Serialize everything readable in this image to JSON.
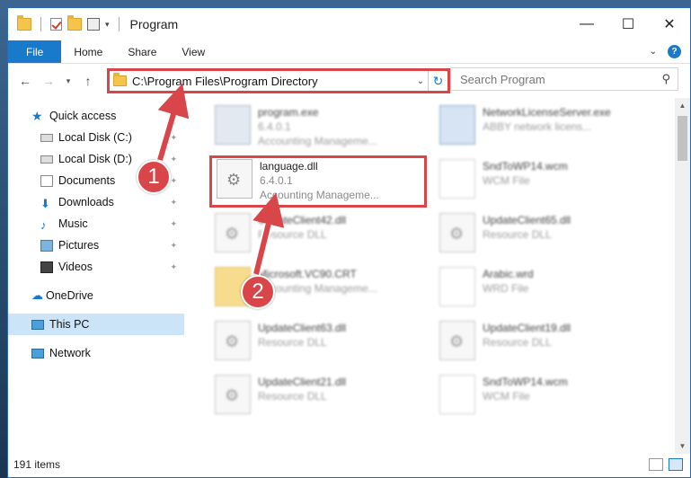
{
  "window": {
    "title": "Program"
  },
  "ribbon": {
    "tabs": [
      "File",
      "Home",
      "Share",
      "View"
    ]
  },
  "address": {
    "path": "C:\\Program Files\\Program Directory"
  },
  "search": {
    "placeholder": "Search Program"
  },
  "sidebar": {
    "quick_access": "Quick access",
    "items": [
      {
        "label": "Local Disk (C:)",
        "icon": "disk-icon"
      },
      {
        "label": "Local Disk (D:)",
        "icon": "disk-icon"
      },
      {
        "label": "Documents",
        "icon": "documents-icon"
      },
      {
        "label": "Downloads",
        "icon": "downloads-icon"
      },
      {
        "label": "Music",
        "icon": "music-icon"
      },
      {
        "label": "Pictures",
        "icon": "pictures-icon"
      },
      {
        "label": "Videos",
        "icon": "videos-icon"
      }
    ],
    "onedrive": "OneDrive",
    "this_pc": "This PC",
    "network": "Network"
  },
  "files": [
    {
      "name": "program.exe",
      "line2": "6.4.0.1",
      "line3": "Accounting Manageme...",
      "icon": "app"
    },
    {
      "name": "NetworkLicenseServer.exe",
      "line2": "ABBY network licens...",
      "line3": "",
      "icon": "blue"
    },
    {
      "name": "language.dll",
      "line2": "6.4.0.1",
      "line3": "Accounting Manageme...",
      "icon": "gear"
    },
    {
      "name": "SndToWP14.wcm",
      "line2": "WCM File",
      "line3": "",
      "icon": "blank"
    },
    {
      "name": "UpdateClient42.dll",
      "line2": "Resource DLL",
      "line3": "",
      "icon": "gear"
    },
    {
      "name": "UpdateClient65.dll",
      "line2": "Resource DLL",
      "line3": "",
      "icon": "gear"
    },
    {
      "name": "Microsoft.VC90.CRT",
      "line2": "",
      "line3": "Accounting Manageme...",
      "icon": "folder"
    },
    {
      "name": "Arabic.wrd",
      "line2": "WRD File",
      "line3": "",
      "icon": "blank"
    },
    {
      "name": "UpdateClient63.dll",
      "line2": "Resource DLL",
      "line3": "",
      "icon": "gear"
    },
    {
      "name": "UpdateClient19.dll",
      "line2": "Resource DLL",
      "line3": "",
      "icon": "gear"
    },
    {
      "name": "UpdateClient21.dll",
      "line2": "Resource DLL",
      "line3": "",
      "icon": "gear"
    },
    {
      "name": "SndToWP14.wcm",
      "line2": "WCM File",
      "line3": "",
      "icon": "blank"
    }
  ],
  "status": {
    "count": "191 items"
  },
  "callouts": [
    "1",
    "2"
  ],
  "colors": {
    "highlight": "#d9464a",
    "accent": "#1979ca"
  }
}
